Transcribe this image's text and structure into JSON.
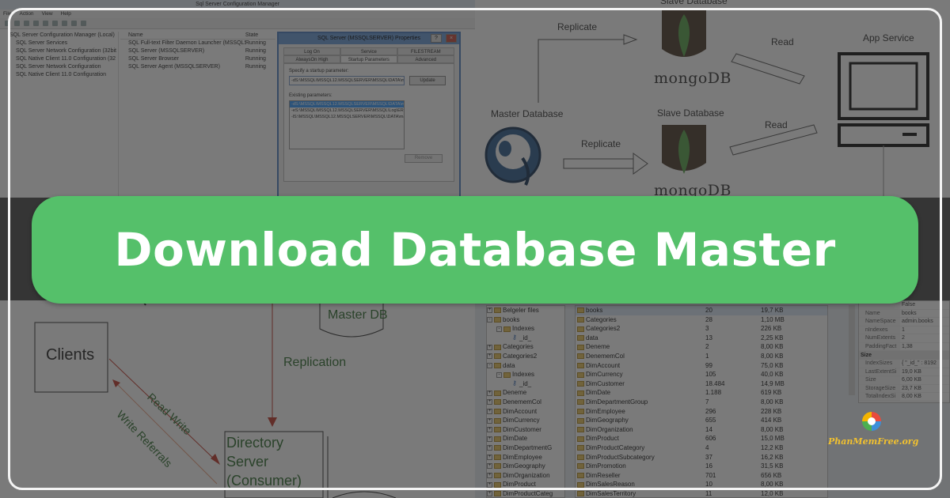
{
  "banner": {
    "title": "Download Database Master"
  },
  "watermark": {
    "text": "PhanMemFree.org"
  },
  "config_manager": {
    "window_title": "Sql Server Configuration Manager",
    "menu": [
      "File",
      "Action",
      "View",
      "Help"
    ],
    "tree": [
      "SQL Server Configuration Manager (Local)",
      "SQL Server Services",
      "SQL Server Network Configuration (32bit",
      "SQL Native Client 11.0 Configuration (32",
      "SQL Server Network Configuration",
      "SQL Native Client 11.0 Configuration"
    ],
    "columns": {
      "name": "Name",
      "state": "State"
    },
    "services": [
      {
        "name": "SQL Full-text Filter Daemon Launcher (MSSQLSERVER)",
        "state": "Running"
      },
      {
        "name": "SQL Server (MSSQLSERVER)",
        "state": "Running"
      },
      {
        "name": "SQL Server Browser",
        "state": "Running"
      },
      {
        "name": "SQL Server Agent (MSSQLSERVER)",
        "state": "Running"
      }
    ],
    "dialog": {
      "title": "SQL Server (MSSQLSERVER) Properties",
      "help": "?",
      "close": "×",
      "tabs": [
        "Log On",
        "Service",
        "FILESTREAM",
        "AlwaysOn High Availability",
        "Startup Parameters",
        "Advanced"
      ],
      "startup_label": "Specify a startup parameter:",
      "startup_value": "-dS:\\MSSQL\\MSSQL12.MSSQLSERVER\\MSSQL\\DATA\\m",
      "update_button": "Update",
      "existing_label": "Existing parameters:",
      "existing": [
        "-dS:\\MSSQL\\MSSQL12.MSSQLSERVER\\MSSQL\\DATA\\ma",
        "-eS:\\MSSQL\\MSSQL12.MSSQLSERVER\\MSSQL\\Log\\ERR",
        "-lS:\\MSSQL\\MSSQL12.MSSQLSERVER\\MSSQL\\DATA\\ma"
      ],
      "remove_button": "Remove"
    }
  },
  "mongo_diagram": {
    "slave_top": "Slave Database",
    "slave_bottom": "Slave Database",
    "master": "Master Database",
    "app_service": "App Service",
    "replicate_top": "Replicate",
    "replicate_bottom": "Replicate",
    "read_top": "Read",
    "read_bottom": "Read",
    "mongo_word": "mongoDB"
  },
  "directory_diagram": {
    "clients": "Clients",
    "master_db": "Master DB",
    "replication": "Replication",
    "read_write": "Read Write",
    "write_referrals": "Write Referrals",
    "directory_server": [
      "Directory",
      "Server",
      "(Consumer)"
    ]
  },
  "explorer": {
    "tree": [
      {
        "label": "Belgeler files",
        "kind": "folder",
        "exp": "+"
      },
      {
        "label": "books",
        "kind": "folder",
        "exp": "-"
      },
      {
        "label": "Indexes",
        "kind": "folder",
        "exp": "-",
        "indent": 1
      },
      {
        "label": "_id_",
        "kind": "key",
        "indent": 2
      },
      {
        "label": "Categories",
        "kind": "folder",
        "exp": "+"
      },
      {
        "label": "Categories2",
        "kind": "folder",
        "exp": "+"
      },
      {
        "label": "data",
        "kind": "folder",
        "exp": "-"
      },
      {
        "label": "Indexes",
        "kind": "folder",
        "exp": "-",
        "indent": 1
      },
      {
        "label": "_id_",
        "kind": "key",
        "indent": 2
      },
      {
        "label": "Deneme",
        "kind": "folder",
        "exp": "+"
      },
      {
        "label": "DenememCol",
        "kind": "folder",
        "exp": "+"
      },
      {
        "label": "DimAccount",
        "kind": "folder",
        "exp": "+"
      },
      {
        "label": "DimCurrency",
        "kind": "folder",
        "exp": "+"
      },
      {
        "label": "DimCustomer",
        "kind": "folder",
        "exp": "+"
      },
      {
        "label": "DimDate",
        "kind": "folder",
        "exp": "+"
      },
      {
        "label": "DimDepartmentG",
        "kind": "folder",
        "exp": "+"
      },
      {
        "label": "DimEmployee",
        "kind": "folder",
        "exp": "+"
      },
      {
        "label": "DimGeography",
        "kind": "folder",
        "exp": "+"
      },
      {
        "label": "DimOrganization",
        "kind": "folder",
        "exp": "+"
      },
      {
        "label": "DimProduct",
        "kind": "folder",
        "exp": "+"
      },
      {
        "label": "DimProductCateg",
        "kind": "folder",
        "exp": "+"
      }
    ],
    "collections": [
      {
        "name": "books",
        "count": "20",
        "size": "19,7 KB"
      },
      {
        "name": "Categories",
        "count": "28",
        "size": "1,10 MB"
      },
      {
        "name": "Categories2",
        "count": "3",
        "size": "226 KB"
      },
      {
        "name": "data",
        "count": "13",
        "size": "2,25 KB"
      },
      {
        "name": "Deneme",
        "count": "2",
        "size": "8,00 KB"
      },
      {
        "name": "DenememCol",
        "count": "1",
        "size": "8,00 KB"
      },
      {
        "name": "DimAccount",
        "count": "99",
        "size": "75,0 KB"
      },
      {
        "name": "DimCurrency",
        "count": "105",
        "size": "40,0 KB"
      },
      {
        "name": "DimCustomer",
        "count": "18.484",
        "size": "14,9 MB"
      },
      {
        "name": "DimDate",
        "count": "1.188",
        "size": "619 KB"
      },
      {
        "name": "DimDepartmentGroup",
        "count": "7",
        "size": "8,00 KB"
      },
      {
        "name": "DimEmployee",
        "count": "296",
        "size": "228 KB"
      },
      {
        "name": "DimGeography",
        "count": "655",
        "size": "414 KB"
      },
      {
        "name": "DimOrganization",
        "count": "14",
        "size": "8,00 KB"
      },
      {
        "name": "DimProduct",
        "count": "606",
        "size": "15,0 MB"
      },
      {
        "name": "DimProductCategory",
        "count": "4",
        "size": "12,2 KB"
      },
      {
        "name": "DimProductSubcategory",
        "count": "37",
        "size": "16,2 KB"
      },
      {
        "name": "DimPromotion",
        "count": "16",
        "size": "31,5 KB"
      },
      {
        "name": "DimReseller",
        "count": "701",
        "size": "656 KB"
      },
      {
        "name": "DimSalesReason",
        "count": "10",
        "size": "8,00 KB"
      },
      {
        "name": "DimSalesTerritory",
        "count": "11",
        "size": "12,0 KB"
      }
    ],
    "search_tail": "rch",
    "props_top": [
      {
        "key": "",
        "value": "False"
      },
      {
        "key": "Name",
        "value": "books"
      },
      {
        "key": "NameSpace",
        "value": "admin.books"
      },
      {
        "key": "nIndexes",
        "value": "1"
      },
      {
        "key": "NumExtents",
        "value": "2"
      },
      {
        "key": "PaddingFact",
        "value": "1,38"
      }
    ],
    "props_section": "Size",
    "props_size": [
      {
        "key": "IndexSizes",
        "value": "{ \"_id_\" : 8192"
      },
      {
        "key": "LastExtentSi",
        "value": "19,0 KB"
      },
      {
        "key": "Size",
        "value": "6,00 KB"
      },
      {
        "key": "StorageSize",
        "value": "23,7 KB"
      },
      {
        "key": "TotalIndexSi",
        "value": "8,00 KB"
      }
    ]
  }
}
